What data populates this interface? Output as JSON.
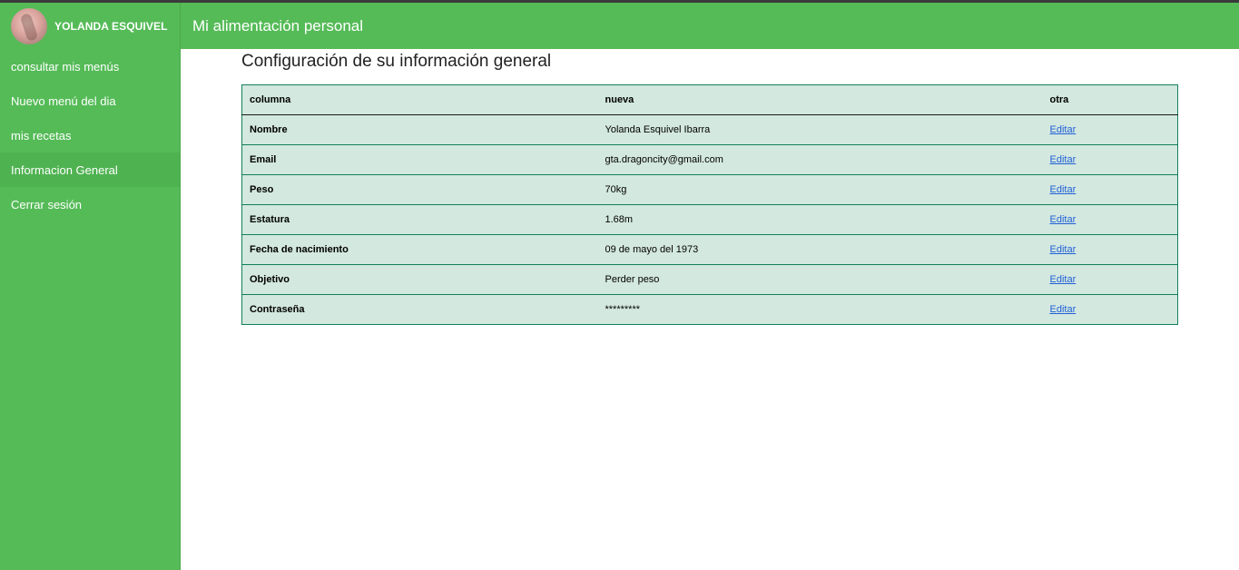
{
  "sidebar": {
    "user_name": "YOLANDA ESQUIVEL",
    "items": [
      {
        "label": "consultar mis menús"
      },
      {
        "label": "Nuevo menú del dia"
      },
      {
        "label": "mis recetas"
      },
      {
        "label": "Informacion General"
      },
      {
        "label": "Cerrar sesión"
      }
    ]
  },
  "header": {
    "title": "Mi alimentación personal"
  },
  "main": {
    "title": "Configuración de su información general",
    "table": {
      "columns": [
        "columna",
        "nueva",
        "otra"
      ],
      "rows": [
        {
          "field": "Nombre",
          "value": "Yolanda Esquivel Ibarra",
          "action": "Editar"
        },
        {
          "field": "Email",
          "value": "gta.dragoncity@gmail.com",
          "action": "Editar"
        },
        {
          "field": "Peso",
          "value": "70kg",
          "action": "Editar"
        },
        {
          "field": "Estatura",
          "value": "1.68m",
          "action": "Editar"
        },
        {
          "field": "Fecha de nacimiento",
          "value": "09 de mayo del 1973",
          "action": "Editar"
        },
        {
          "field": "Objetivo",
          "value": "Perder peso",
          "action": "Editar"
        },
        {
          "field": "Contraseña",
          "value": "*********",
          "action": "Editar"
        }
      ]
    }
  },
  "colors": {
    "accent": "#55bb57",
    "table_bg": "#d3e8df",
    "table_border": "#12805a",
    "link": "#1f5fd6"
  }
}
